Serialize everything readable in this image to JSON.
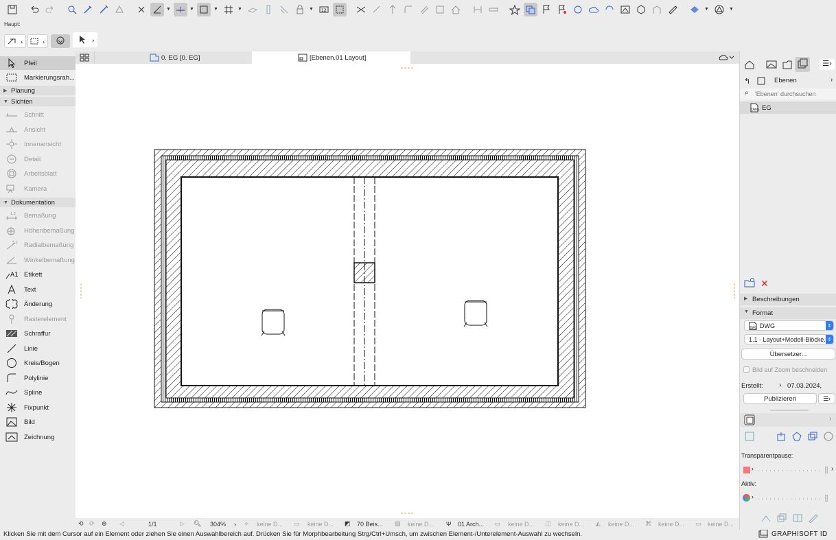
{
  "toolbar": {
    "haupt_label": "Haupt:"
  },
  "palette": {
    "items": [
      {
        "label": "Pfeil",
        "icon": "arrow-pointer-icon"
      },
      {
        "label": "Markierungsrah...",
        "icon": "marquee-icon"
      },
      {
        "label": "Planung",
        "icon": "section-triangle"
      },
      {
        "label": "Sichten",
        "icon": "section-triangle"
      },
      {
        "label": "Schnitt",
        "icon": "section-icon"
      },
      {
        "label": "Ansicht",
        "icon": "elevation-icon"
      },
      {
        "label": "Innenansicht",
        "icon": "interior-elevation-icon"
      },
      {
        "label": "Detail",
        "icon": "detail-icon"
      },
      {
        "label": "Arbeitsblatt",
        "icon": "worksheet-icon"
      },
      {
        "label": "Kamera",
        "icon": "camera-icon"
      },
      {
        "label": "Dokumentation",
        "icon": "section-triangle"
      },
      {
        "label": "Bemaßung",
        "icon": "dimension-icon"
      },
      {
        "label": "Höhenbemaßung",
        "icon": "level-dimension-icon"
      },
      {
        "label": "Radialbemaßung",
        "icon": "radial-dimension-icon"
      },
      {
        "label": "Winkelbemaßung",
        "icon": "angle-dimension-icon"
      },
      {
        "label": "Etikett",
        "icon": "label-icon"
      },
      {
        "label": "Text",
        "icon": "text-icon"
      },
      {
        "label": "Änderung",
        "icon": "change-icon"
      },
      {
        "label": "Rasterelement",
        "icon": "grid-element-icon"
      },
      {
        "label": "Schraffur",
        "icon": "fill-icon"
      },
      {
        "label": "Linie",
        "icon": "line-icon"
      },
      {
        "label": "Kreis/Bogen",
        "icon": "circle-icon"
      },
      {
        "label": "Polylinie",
        "icon": "polyline-icon"
      },
      {
        "label": "Spline",
        "icon": "spline-icon"
      },
      {
        "label": "Fixpunkt",
        "icon": "hotspot-icon"
      },
      {
        "label": "Bild",
        "icon": "image-icon"
      },
      {
        "label": "Zeichnung",
        "icon": "drawing-icon"
      }
    ]
  },
  "tabs": [
    {
      "label": "0. EG [0. EG]"
    },
    {
      "label": "[Ebenen.01 Layout]"
    }
  ],
  "navbar": {
    "page": "1/1",
    "zoom": "304%",
    "items": [
      "keine D...",
      "keine D...",
      "70 Beis...",
      "keine D...",
      "01 Arch...",
      "keine D...",
      "keine D...",
      "keine D...",
      "keine D...",
      "keine D..."
    ]
  },
  "statusbar": {
    "text": "Klicken Sie mit dem Cursor auf ein Element oder ziehen Sie einen Auswahlbereich auf. Drücken Sie für Morphbearbeitung Strg/Ctrl+Umsch, um zwischen Element-/Unterelement-Auswahl zu wechseln.",
    "brand": "GRAPHISOFT ID"
  },
  "right_panel": {
    "navigator_title": "Ebenen",
    "search_placeholder": "'Ebenen' durchsuchen",
    "tree_item": "EG",
    "section_beschreibungen": "Beschreibungen",
    "section_format": "Format",
    "format_value": "DWG",
    "translator_value": "1.1 - Layout+Modell-Blöcke...",
    "translator_button": "Übersetzer...",
    "crop_checkbox": "Bild auf Zoom beschneiden",
    "created_label": "Erstellt:",
    "created_value": "07.03.2024,",
    "publish_button": "Publizieren",
    "transparent_label": "Transparentpause:",
    "active_label": "Aktiv:"
  }
}
